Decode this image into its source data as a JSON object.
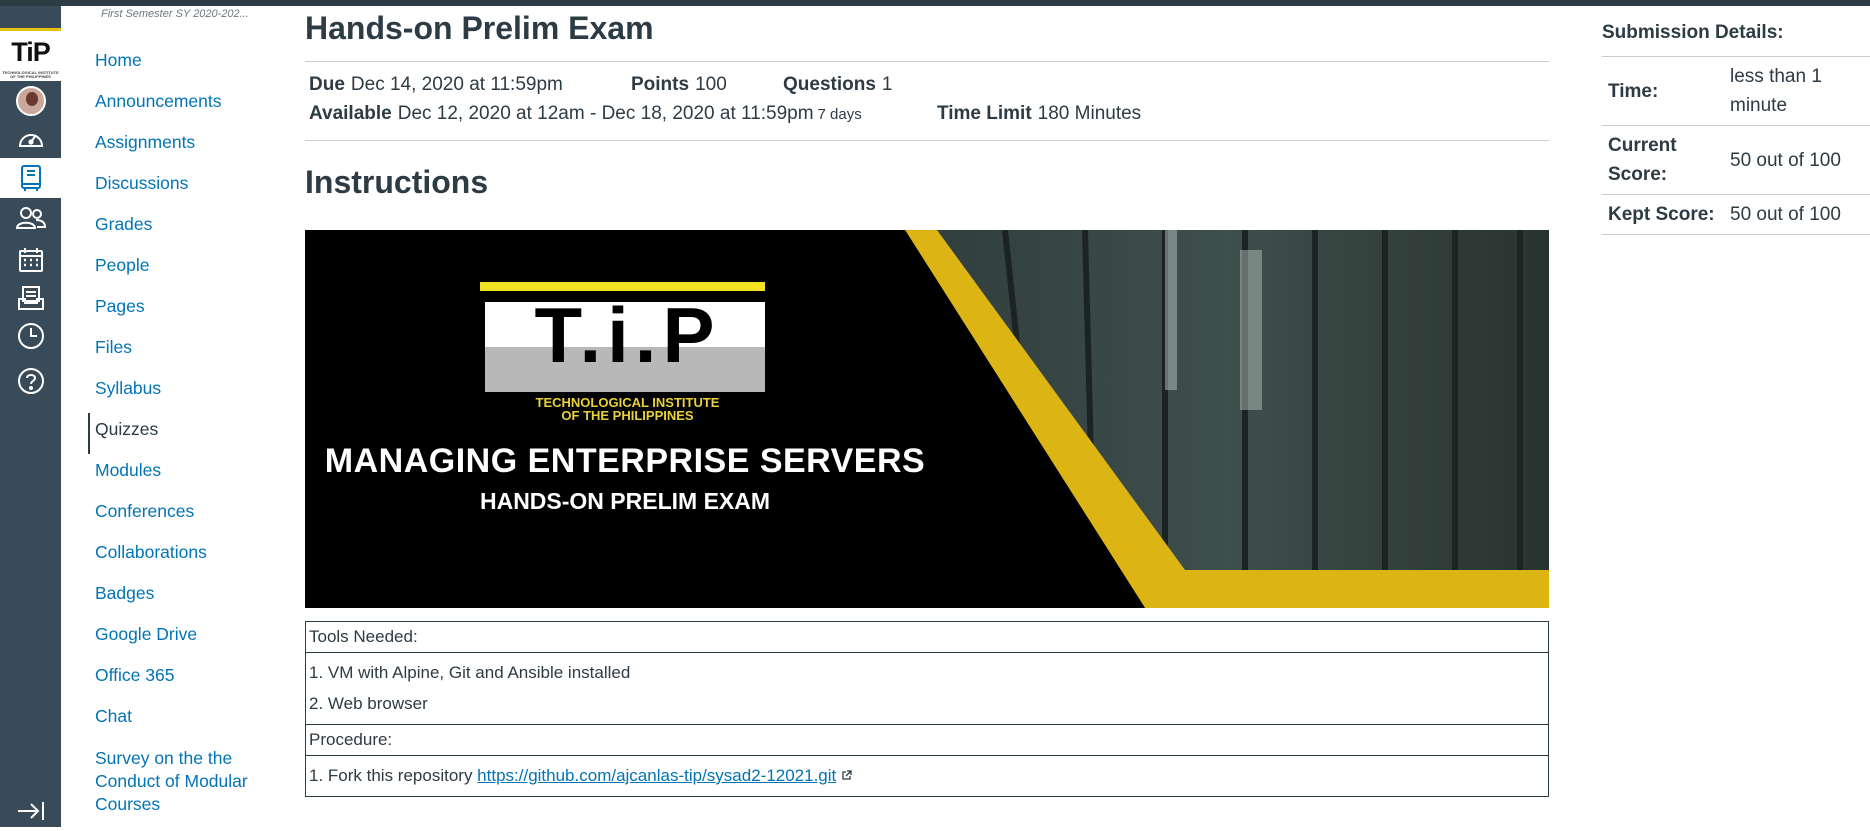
{
  "global_nav": {
    "logo_text": "TiP",
    "logo_small": "TECHNOLOGICAL INSTITUTE OF THE PHILIPPINES",
    "items": [
      {
        "name": "account-avatar",
        "icon": "avatar"
      },
      {
        "name": "dashboard",
        "icon": "dashboard-icon"
      },
      {
        "name": "courses",
        "icon": "book-icon"
      },
      {
        "name": "groups",
        "icon": "people-icon"
      },
      {
        "name": "calendar",
        "icon": "calendar-icon"
      },
      {
        "name": "inbox",
        "icon": "inbox-icon"
      },
      {
        "name": "history",
        "icon": "clock-icon"
      },
      {
        "name": "help",
        "icon": "help-icon"
      }
    ],
    "collapse_icon": "collapse-nav-icon"
  },
  "course_nav": {
    "term": "First Semester SY 2020-202...",
    "items": [
      {
        "label": "Home"
      },
      {
        "label": "Announcements"
      },
      {
        "label": "Assignments"
      },
      {
        "label": "Discussions"
      },
      {
        "label": "Grades"
      },
      {
        "label": "People"
      },
      {
        "label": "Pages"
      },
      {
        "label": "Files"
      },
      {
        "label": "Syllabus"
      },
      {
        "label": "Quizzes",
        "active": true
      },
      {
        "label": "Modules"
      },
      {
        "label": "Conferences"
      },
      {
        "label": "Collaborations"
      },
      {
        "label": "Badges"
      },
      {
        "label": "Google Drive"
      },
      {
        "label": "Office 365"
      },
      {
        "label": "Chat"
      },
      {
        "label": "Survey on the the Conduct of Modular Courses"
      }
    ]
  },
  "quiz": {
    "title": "Hands-on Prelim Exam",
    "due_label": "Due",
    "due_value": "Dec 14, 2020 at 11:59pm",
    "points_label": "Points",
    "points_value": "100",
    "questions_label": "Questions",
    "questions_value": "1",
    "available_label": "Available",
    "available_value": "Dec 12, 2020 at 12am - Dec 18, 2020 at 11:59pm",
    "available_days": "7 days",
    "time_limit_label": "Time Limit",
    "time_limit_value": "180 Minutes",
    "instructions_heading": "Instructions"
  },
  "banner": {
    "logo_letters": "T.i.P",
    "institute_line1": "TECHNOLOGICAL INSTITUTE",
    "institute_line2": "OF THE PHILIPPINES",
    "course_title": "MANAGING ENTERPRISE SERVERS",
    "exam_title": "HANDS-ON PRELIM EXAM",
    "accent_color": "#dcb414"
  },
  "instructions": {
    "tools_header": "Tools Needed:",
    "tools": [
      "1. VM with Alpine, Git and Ansible installed",
      "2. Web browser"
    ],
    "procedure_header": "Procedure:",
    "step1_prefix": "1. Fork this repository ",
    "step1_link": "https://github.com/ajcanlas-tip/sysad2-12021.git"
  },
  "submission": {
    "heading": "Submission Details:",
    "time_label": "Time:",
    "time_value": "less than 1 minute",
    "current_label": "Current Score:",
    "current_value": "50 out of 100",
    "kept_label": "Kept Score:",
    "kept_value": "50 out of 100"
  },
  "colors": {
    "nav_bg": "#394b58",
    "link": "#0374b5",
    "text": "#2d3b45"
  }
}
